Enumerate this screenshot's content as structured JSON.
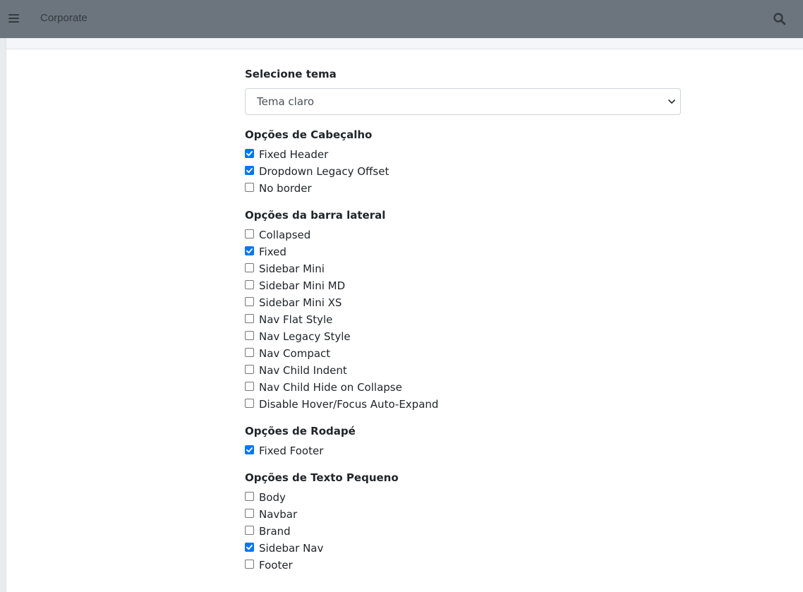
{
  "header": {
    "brand": "Corporate"
  },
  "icons": {
    "menu": "hamburger-menu-icon",
    "search": "search-icon",
    "select": "chevron-down-icon"
  },
  "colors": {
    "navbar": "#6c757d",
    "checkbox_checked": "#0075ff"
  },
  "theme": {
    "label": "Selecione tema",
    "selected": "Tema claro"
  },
  "groups": [
    {
      "title": "Opções de Cabeçalho",
      "items": [
        {
          "label": "Fixed Header",
          "checked": true
        },
        {
          "label": "Dropdown Legacy Offset",
          "checked": true
        },
        {
          "label": "No border",
          "checked": false
        }
      ]
    },
    {
      "title": "Opções da barra lateral",
      "items": [
        {
          "label": "Collapsed",
          "checked": false
        },
        {
          "label": "Fixed",
          "checked": true
        },
        {
          "label": "Sidebar Mini",
          "checked": false
        },
        {
          "label": "Sidebar Mini MD",
          "checked": false
        },
        {
          "label": "Sidebar Mini XS",
          "checked": false
        },
        {
          "label": "Nav Flat Style",
          "checked": false
        },
        {
          "label": "Nav Legacy Style",
          "checked": false
        },
        {
          "label": "Nav Compact",
          "checked": false
        },
        {
          "label": "Nav Child Indent",
          "checked": false
        },
        {
          "label": "Nav Child Hide on Collapse",
          "checked": false
        },
        {
          "label": "Disable Hover/Focus Auto-Expand",
          "checked": false
        }
      ]
    },
    {
      "title": "Opções de Rodapé",
      "items": [
        {
          "label": "Fixed Footer",
          "checked": true
        }
      ]
    },
    {
      "title": "Opções de Texto Pequeno",
      "items": [
        {
          "label": "Body",
          "checked": false
        },
        {
          "label": "Navbar",
          "checked": false
        },
        {
          "label": "Brand",
          "checked": false
        },
        {
          "label": "Sidebar Nav",
          "checked": true
        },
        {
          "label": "Footer",
          "checked": false
        }
      ]
    }
  ]
}
